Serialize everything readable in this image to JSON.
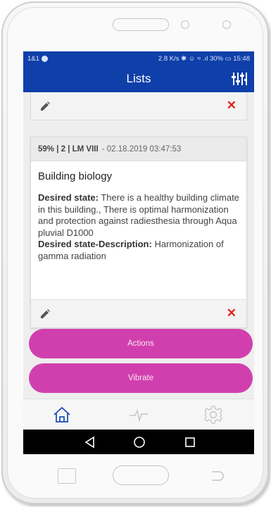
{
  "status_bar": {
    "left_text": "1&1",
    "right_text": "2.8 K/s ✱ ☺ ≈ .ıl 30% ▭ 15:48"
  },
  "header": {
    "title": "Lists",
    "filter_icon": "sliders-icon"
  },
  "entry": {
    "meta": "59% | 2 | LM VIII",
    "separator": " - ",
    "date": "02.18.2019 03:47:53",
    "title": "Building biology",
    "desired_state_label": "Desired state:",
    "desired_state_text": " There is a healthy building climate in this building., There is optimal harmonization and protection against radiesthesia through Aqua pluvial D1000",
    "desired_state_desc_label": "Desired state-Description:",
    "desired_state_desc_text": " Harmonization of gamma radiation"
  },
  "buttons": {
    "actions": "Actions",
    "vibrate": "Vibrate"
  },
  "tabs": [
    "home-icon",
    "pulse-icon",
    "settings-icon"
  ],
  "nav": [
    "back-icon",
    "home-circle-icon",
    "recent-apps-icon"
  ],
  "colors": {
    "header": "#0f3fa8",
    "button": "#d13fae",
    "delete": "#e0211b",
    "tab_active": "#1e4fb4"
  }
}
